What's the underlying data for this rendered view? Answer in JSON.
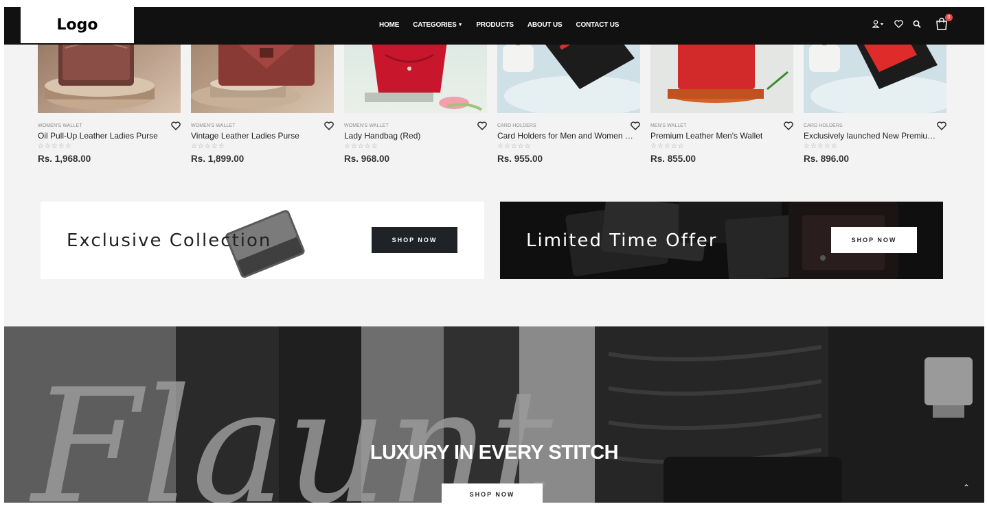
{
  "header": {
    "logo": "Logo",
    "nav": [
      {
        "label": "HOME"
      },
      {
        "label": "CATEGORIES",
        "has_dropdown": true
      },
      {
        "label": "PRODUCTS"
      },
      {
        "label": "ABOUT US"
      },
      {
        "label": "CONTACT US"
      }
    ],
    "icons": [
      "user-icon",
      "heart-icon",
      "search-icon",
      "cart-icon"
    ],
    "cart_count": "0"
  },
  "products": [
    {
      "category": "WOMEN'S WALLET",
      "name": "Oil Pull-Up Leather Ladies Purse",
      "stars": "☆☆☆☆☆",
      "price": "Rs. 1,968.00",
      "rating": 0
    },
    {
      "category": "WOMEN'S WALLET",
      "name": "Vintage Leather Ladies Purse",
      "stars": "☆☆☆☆☆",
      "price": "Rs. 1,899.00",
      "rating": 0
    },
    {
      "category": "WOMEN'S WALLET",
      "name": "Lady Handbag (Red)",
      "stars": "☆☆☆☆☆",
      "price": "Rs. 968.00",
      "rating": 0
    },
    {
      "category": "CARD HOLDERS",
      "name": "Card Holders for Men and Women | …",
      "stars": "☆☆☆☆☆",
      "price": "Rs. 955.00",
      "rating": 0
    },
    {
      "category": "MEN'S WALLET",
      "name": "Premium Leather Men's Wallet",
      "stars": "☆☆☆☆☆",
      "price": "Rs. 855.00",
      "rating": 0
    },
    {
      "category": "CARD HOLDERS",
      "name": "Exclusively launched New Premium …",
      "stars": "☆☆☆☆☆",
      "price": "Rs. 896.00",
      "rating": 0
    }
  ],
  "banners": [
    {
      "title": "Exclusive Collection",
      "button": "SHOP NOW"
    },
    {
      "title": "Limited Time Offer",
      "button": "SHOP NOW"
    }
  ],
  "hero": {
    "script_text": "Flaunt",
    "title": "LUXURY IN EVERY STITCH",
    "button": "SHOP NOW"
  },
  "scroll_top": "⌃",
  "colors": {
    "header_bg": "#111111",
    "page_bg": "#f3f3f3",
    "badge": "#e14b4b",
    "dark_button": "#1f2328"
  }
}
